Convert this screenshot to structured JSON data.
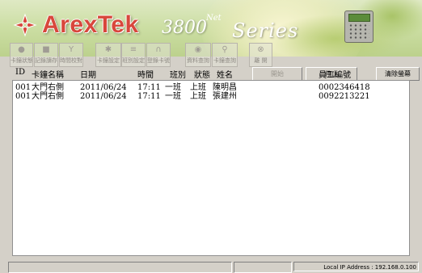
{
  "banner": {
    "brand": "ArexTek",
    "model": "3800",
    "model_suffix": "Net",
    "series": "Series",
    "brand_color": "#d8473c"
  },
  "toolbar": {
    "items": [
      {
        "icon": "circle-icon",
        "glyph": "●",
        "label": "卡鐘狀態"
      },
      {
        "icon": "record-icon",
        "glyph": "■",
        "label": "記錄讀存"
      },
      {
        "icon": "filter-icon",
        "glyph": "Y",
        "label": "時間校對"
      },
      {
        "icon": "gear-icon",
        "glyph": "✱",
        "label": "卡鐘設定"
      },
      {
        "icon": "shift-icon",
        "glyph": "≡",
        "label": "班別設定"
      },
      {
        "icon": "card-icon",
        "glyph": "∩",
        "label": "登錄卡號"
      },
      {
        "icon": "data-icon",
        "glyph": "◉",
        "label": "資料查詢"
      },
      {
        "icon": "search-icon",
        "glyph": "⚲",
        "label": "卡鐘查詢"
      },
      {
        "icon": "exit-icon",
        "glyph": "⊗",
        "label": "離 開"
      }
    ]
  },
  "controls": {
    "start_label": "開始",
    "stop_label": "停止",
    "clear_label": "清除螢幕"
  },
  "list": {
    "columns": [
      "ID",
      "卡鐘名稱",
      "日期",
      "時間",
      "班別",
      "狀態",
      "姓名",
      "員工編號"
    ],
    "rows": [
      {
        "id": "001",
        "name": "大門右側",
        "date": "2011/06/24",
        "time": "17:11",
        "shift": "一班",
        "status": "上班",
        "person": "陳明昌",
        "emp": "0002346418"
      },
      {
        "id": "001",
        "name": "大門右側",
        "date": "2011/06/24",
        "time": "17:11",
        "shift": "一班",
        "status": "上班",
        "person": "張建州",
        "emp": "0092213221"
      }
    ]
  },
  "statusbar": {
    "text": "Local IP Address : 192.168.0.100"
  }
}
